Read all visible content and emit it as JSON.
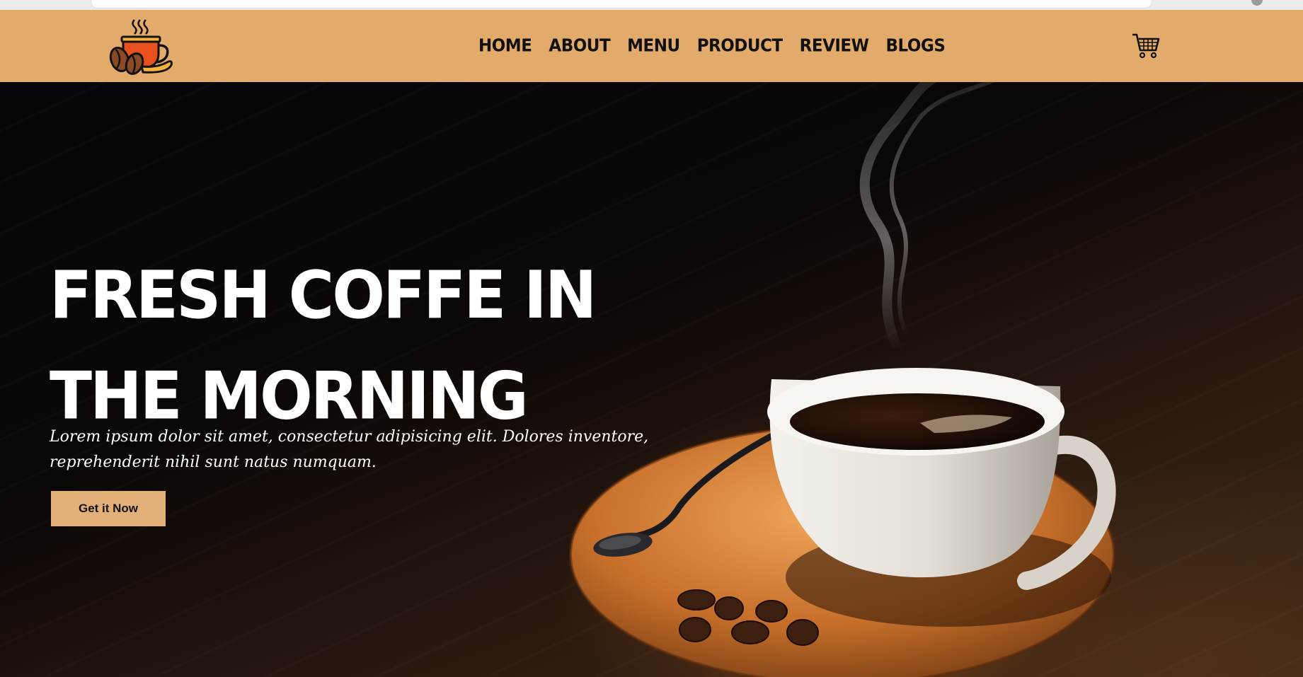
{
  "nav": {
    "items": [
      {
        "label": "HOME"
      },
      {
        "label": "ABOUT"
      },
      {
        "label": "MENU"
      },
      {
        "label": "PRODUCT"
      },
      {
        "label": "REVIEW"
      },
      {
        "label": "BLOGS"
      }
    ],
    "cart_icon": "shopping-cart-icon",
    "logo_icon": "coffee-cup-logo-icon"
  },
  "hero": {
    "title": "FRESH COFFE IN THE MORNING",
    "text": "Lorem ipsum dolor sit amet, consectetur adipisicing elit. Dolores inventore, reprehenderit nihil sunt natus numquam.",
    "cta_label": "Get it Now"
  },
  "colors": {
    "nav_bg": "#e3ab6b",
    "cta_bg": "#e3b07a",
    "hero_text": "#ffffff"
  }
}
